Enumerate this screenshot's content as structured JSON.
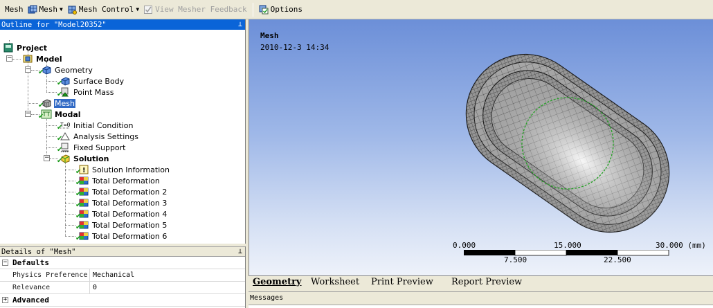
{
  "toolbar": {
    "mesh_label": "Mesh",
    "mesh_menu_label": "Mesh",
    "mesh_control_label": "Mesh Control",
    "view_feedback_label": "View Mesher Feedback",
    "options_label": "Options"
  },
  "outline": {
    "title": "Outline for \"Model20352\"",
    "nodes": {
      "project": "Project",
      "model": "Model",
      "geometry": "Geometry",
      "surface_body": "Surface Body",
      "point_mass": "Point Mass",
      "mesh": "Mesh",
      "modal": "Modal",
      "initial_condition": "Initial Condition",
      "analysis_settings": "Analysis Settings",
      "fixed_support": "Fixed Support",
      "solution": "Solution",
      "solution_information": "Solution Information",
      "total_deformation": "Total Deformation",
      "total_deformation_2": "Total Deformation 2",
      "total_deformation_3": "Total Deformation 3",
      "total_deformation_4": "Total Deformation 4",
      "total_deformation_5": "Total Deformation 5",
      "total_deformation_6": "Total Deformation 6"
    }
  },
  "details": {
    "title": "Details of \"Mesh\"",
    "groups": {
      "defaults": "Defaults",
      "advanced": "Advanced"
    },
    "rows": {
      "physics_preference_key": "Physics Preference",
      "physics_preference_val": "Mechanical",
      "relevance_key": "Relevance",
      "relevance_val": "0"
    }
  },
  "viewport": {
    "title": "Mesh",
    "date": "2010-12-3 14:34",
    "scale": {
      "top_labels": [
        "0.000",
        "15.000",
        "30.000 (mm)"
      ],
      "bottom_labels": [
        "7.500",
        "22.500"
      ]
    }
  },
  "tabs": {
    "geometry": "Geometry",
    "worksheet": "Worksheet",
    "print_preview": "Print Preview",
    "report_preview": "Report Preview"
  },
  "messages": {
    "title": "Messages"
  },
  "colors": {
    "selection": "#316ac5",
    "panel_title": "#0a64d8",
    "check": "#1a9a1a",
    "mesh_fill": "#dcdcdc"
  }
}
